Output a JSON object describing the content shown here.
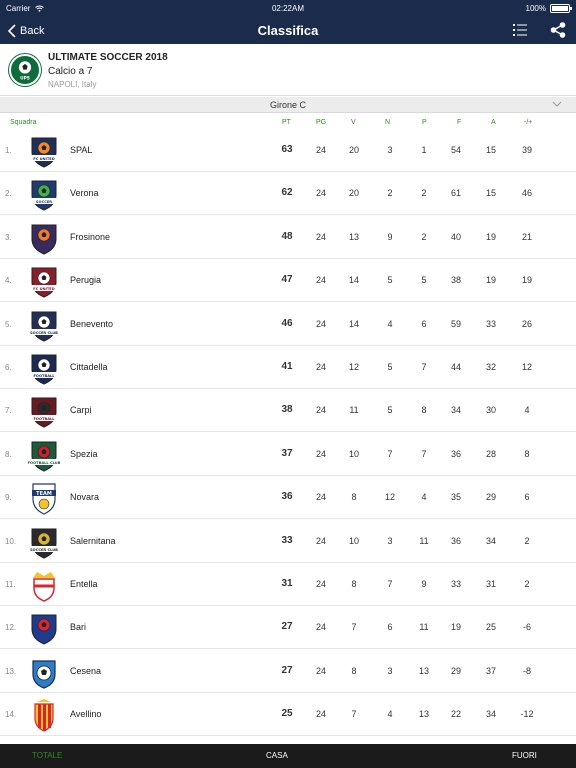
{
  "status": {
    "carrier": "Carrier",
    "time": "02:22AM",
    "battery": "100%"
  },
  "nav": {
    "back_label": "Back",
    "title": "Classifica"
  },
  "tournament": {
    "name": "ULTIMATE SOCCER 2018",
    "subtitle": "Calcio a 7",
    "location": "NAPOLI, Italy",
    "logo_text": "UPS"
  },
  "group": {
    "name": "Girone C"
  },
  "headers": {
    "team": "Squadra",
    "pt": "PT",
    "pg": "PG",
    "v": "V",
    "n": "N",
    "p": "P",
    "f": "F",
    "a": "A",
    "diff": "-/+"
  },
  "rows": [
    {
      "pos": "1.",
      "team": "SPAL",
      "pt": "63",
      "pg": "24",
      "v": "20",
      "n": "3",
      "p": "1",
      "f": "54",
      "a": "15",
      "diff": "39",
      "badge": "fc-united",
      "logo_text": "FC UNITED",
      "c1": "#1f2f57",
      "c2": "#f08a2a"
    },
    {
      "pos": "2.",
      "team": "Verona",
      "pt": "62",
      "pg": "24",
      "v": "20",
      "n": "2",
      "p": "2",
      "f": "61",
      "a": "15",
      "diff": "46",
      "badge": "soccer",
      "logo_text": "SOCCER",
      "c1": "#1f3b6e",
      "c2": "#3fb34a"
    },
    {
      "pos": "3.",
      "team": "Frosinone",
      "pt": "48",
      "pg": "24",
      "v": "13",
      "n": "9",
      "p": "2",
      "f": "40",
      "a": "19",
      "diff": "21",
      "badge": "shield",
      "logo_text": "",
      "c1": "#3a2b5e",
      "c2": "#f07a30"
    },
    {
      "pos": "4.",
      "team": "Perugia",
      "pt": "47",
      "pg": "24",
      "v": "14",
      "n": "5",
      "p": "5",
      "f": "38",
      "a": "19",
      "diff": "19",
      "badge": "fc-united",
      "logo_text": "FC UNITED",
      "c1": "#8c1d2b",
      "c2": "#ffffff"
    },
    {
      "pos": "5.",
      "team": "Benevento",
      "pt": "46",
      "pg": "24",
      "v": "14",
      "n": "4",
      "p": "6",
      "f": "59",
      "a": "33",
      "diff": "26",
      "badge": "soccer-club",
      "logo_text": "SOCCER CLUB",
      "c1": "#1f2f57",
      "c2": "#ffffff"
    },
    {
      "pos": "6.",
      "team": "Cittadella",
      "pt": "41",
      "pg": "24",
      "v": "12",
      "n": "5",
      "p": "7",
      "f": "44",
      "a": "32",
      "diff": "12",
      "badge": "football",
      "logo_text": "FOOTBALL",
      "c1": "#1a2a55",
      "c2": "#ffffff"
    },
    {
      "pos": "7.",
      "team": "Carpi",
      "pt": "38",
      "pg": "24",
      "v": "11",
      "n": "5",
      "p": "8",
      "f": "34",
      "a": "30",
      "diff": "4",
      "badge": "football",
      "logo_text": "FOOTBALL",
      "c1": "#6b1a22",
      "c2": "#2b2b2b"
    },
    {
      "pos": "8.",
      "team": "Spezia",
      "pt": "37",
      "pg": "24",
      "v": "10",
      "n": "7",
      "p": "7",
      "f": "36",
      "a": "28",
      "diff": "8",
      "badge": "football-club",
      "logo_text": "FOOTBALL CLUB",
      "c1": "#1d5a3a",
      "c2": "#c8202e"
    },
    {
      "pos": "9.",
      "team": "Novara",
      "pt": "36",
      "pg": "24",
      "v": "8",
      "n": "12",
      "p": "4",
      "f": "35",
      "a": "29",
      "diff": "6",
      "badge": "team",
      "logo_text": "TEAM",
      "c1": "#1f3b6e",
      "c2": "#f2c230"
    },
    {
      "pos": "10.",
      "team": "Salernitana",
      "pt": "33",
      "pg": "24",
      "v": "10",
      "n": "3",
      "p": "11",
      "f": "36",
      "a": "34",
      "diff": "2",
      "badge": "soccer-club",
      "logo_text": "SOCCER CLUB",
      "c1": "#2b2b2b",
      "c2": "#d9b43a"
    },
    {
      "pos": "11.",
      "team": "Entella",
      "pt": "31",
      "pg": "24",
      "v": "8",
      "n": "7",
      "p": "9",
      "f": "33",
      "a": "31",
      "diff": "2",
      "badge": "crown",
      "logo_text": "",
      "c1": "#d9262e",
      "c2": "#f2c230"
    },
    {
      "pos": "12.",
      "team": "Bari",
      "pt": "27",
      "pg": "24",
      "v": "7",
      "n": "6",
      "p": "11",
      "f": "19",
      "a": "25",
      "diff": "-6",
      "badge": "shield",
      "logo_text": "",
      "c1": "#1f3b8e",
      "c2": "#d9262e"
    },
    {
      "pos": "13.",
      "team": "Cesena",
      "pt": "27",
      "pg": "24",
      "v": "8",
      "n": "3",
      "p": "13",
      "f": "29",
      "a": "37",
      "diff": "-8",
      "badge": "ball-shield",
      "logo_text": "",
      "c1": "#2a7fc8",
      "c2": "#ffffff"
    },
    {
      "pos": "14.",
      "team": "Avellino",
      "pt": "25",
      "pg": "24",
      "v": "7",
      "n": "4",
      "p": "13",
      "f": "22",
      "a": "34",
      "diff": "-12",
      "badge": "stripes",
      "logo_text": "",
      "c1": "#d9262e",
      "c2": "#f2c230"
    }
  ],
  "tabs": {
    "total": "TOTALE",
    "home": "CASA",
    "away": "FUORI"
  },
  "colors": {
    "nav_bg": "#1b2b4c",
    "accent_green": "#2e8b22",
    "tab_bar_bg": "#1b1b1b"
  }
}
